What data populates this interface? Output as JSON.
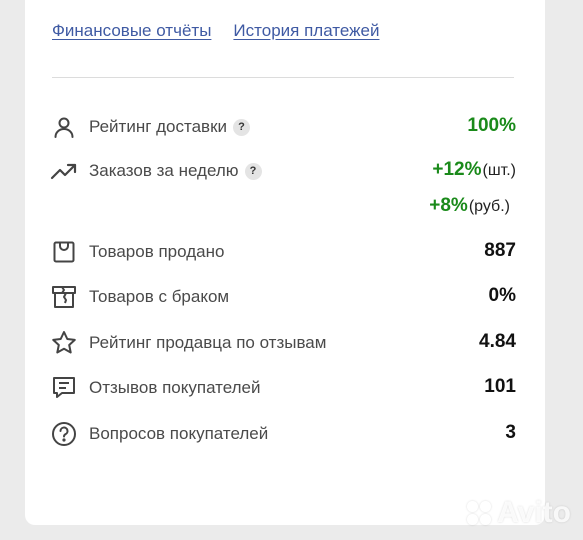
{
  "links": {
    "financial_reports": "Финансовые отчёты",
    "payment_history": "История платежей"
  },
  "stats": {
    "delivery_rating": {
      "label": "Рейтинг доставки",
      "help": "?",
      "value": "100%",
      "icon": "person-icon"
    },
    "weekly_orders": {
      "label": "Заказов за неделю",
      "help": "?",
      "value_pcs": "+12%",
      "unit_pcs": "(шт.)",
      "value_rub": "+8%",
      "unit_rub": "(руб.)",
      "icon": "trending-up-icon"
    },
    "items_sold": {
      "label": "Товаров продано",
      "value": "887",
      "icon": "shopping-bag-icon"
    },
    "defective_items": {
      "label": "Товаров с браком",
      "value": "0%",
      "icon": "damaged-box-icon"
    },
    "seller_rating": {
      "label": "Рейтинг продавца по отзывам",
      "value": "4.84",
      "icon": "star-icon"
    },
    "buyer_reviews": {
      "label": "Отзывов покупателей",
      "value": "101",
      "icon": "comment-icon"
    },
    "buyer_questions": {
      "label": "Вопросов покупателей",
      "value": "3",
      "icon": "question-circle-icon"
    }
  },
  "watermark": {
    "text": "Avito"
  },
  "colors": {
    "link": "#3f5aa3",
    "positive": "#1a8a1a",
    "background": "#ebebeb"
  }
}
